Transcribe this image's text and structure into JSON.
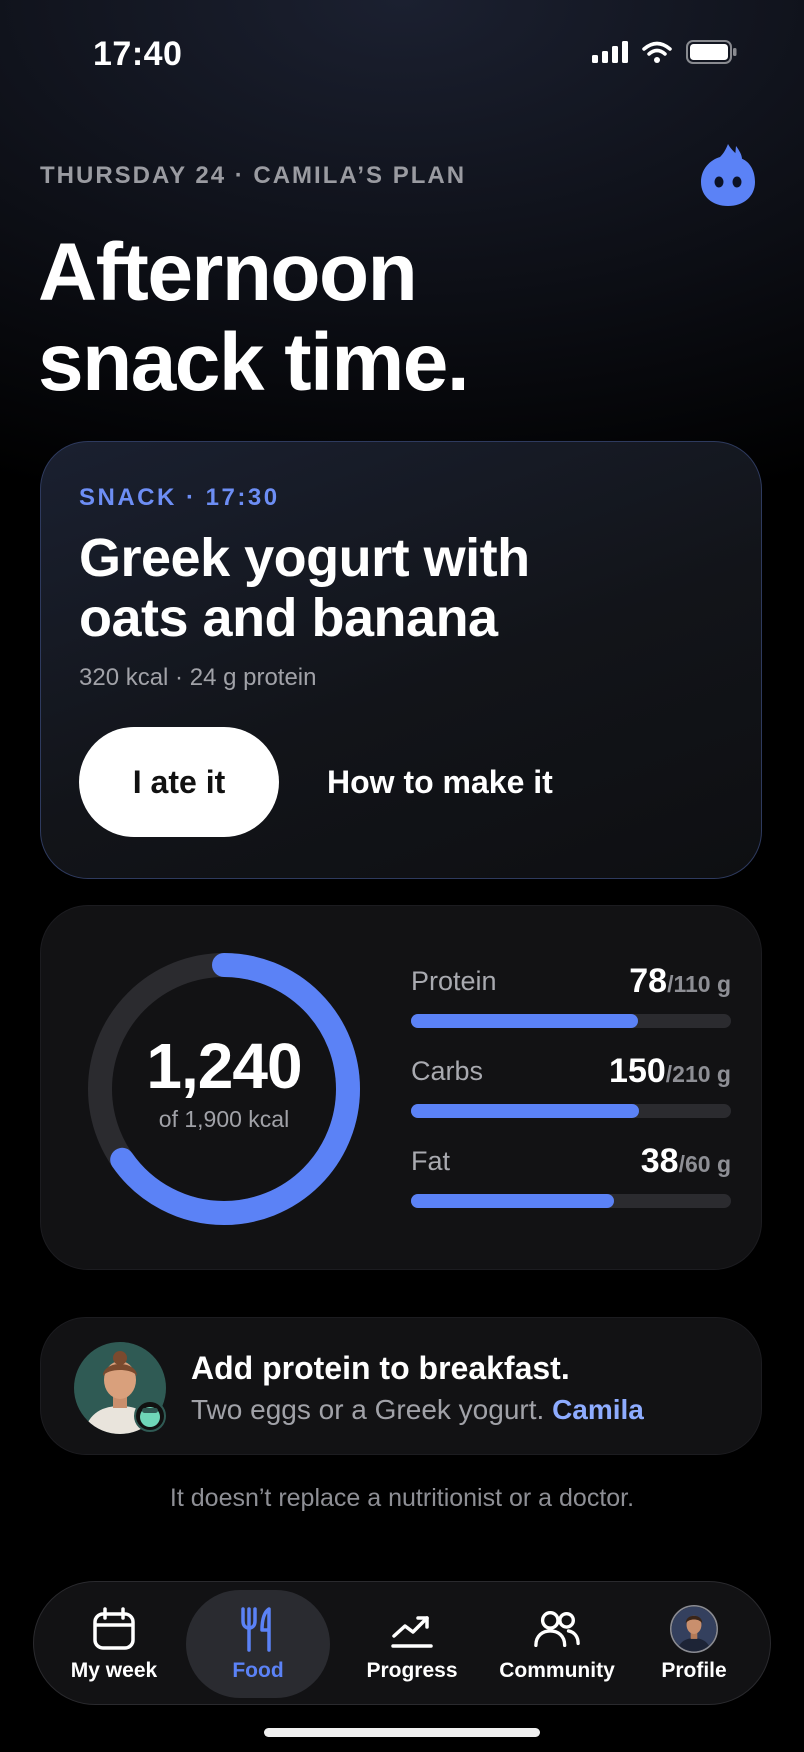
{
  "status": {
    "time": "17:40"
  },
  "header": {
    "date_line": "THURSDAY 24 · CAMILA’S PLAN",
    "headline_1": "Afternoon",
    "headline_2": "snack time."
  },
  "snack": {
    "label": "SNACK · 17:30",
    "title_1": "Greek yogurt with",
    "title_2": "oats and banana",
    "meta": "320 kcal · 24 g protein",
    "primary_action": "I ate it",
    "secondary_action": "How to make it"
  },
  "calories": {
    "value": "1,240",
    "target_text": "of 1,900 kcal",
    "progress": 0.653
  },
  "macros": [
    {
      "label": "Protein",
      "value": "78",
      "target": "/110 g",
      "progress": 0.709
    },
    {
      "label": "Carbs",
      "value": "150",
      "target": "/210 g",
      "progress": 0.714
    },
    {
      "label": "Fat",
      "value": "38",
      "target": "/60 g",
      "progress": 0.633
    }
  ],
  "tip": {
    "title": "Add protein to breakfast.",
    "text": "Two eggs or a Greek yogurt.",
    "author": "Camila"
  },
  "disclaimer": "It doesn’t replace a nutritionist or a doctor.",
  "tabs": [
    {
      "label": "My week",
      "icon": "calendar-icon"
    },
    {
      "label": "Food",
      "icon": "fork-knife-icon",
      "active": true
    },
    {
      "label": "Progress",
      "icon": "trend-chart-icon"
    },
    {
      "label": "Community",
      "icon": "people-icon"
    },
    {
      "label": "Profile",
      "icon": "avatar-icon"
    }
  ],
  "colors": {
    "accent": "#5b82f6",
    "accent_light": "#8eacff",
    "track": "#2b2b2f"
  }
}
